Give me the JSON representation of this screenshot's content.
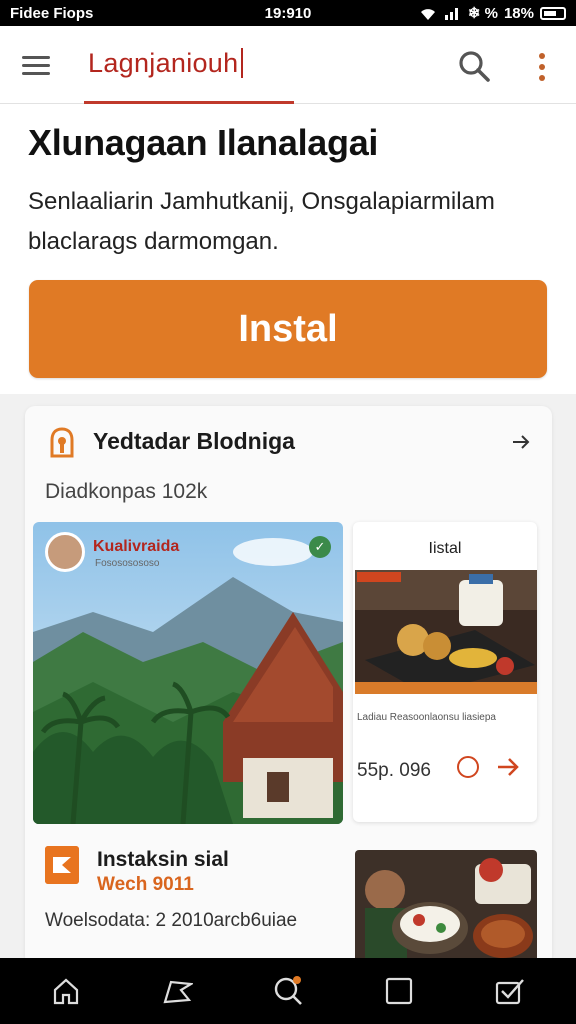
{
  "status": {
    "carrier": "Fidee Fiops",
    "time": "19:910",
    "battery": "18%",
    "indicators": "❄ %"
  },
  "appbar": {
    "title": "Lagnjaniouh",
    "menu_icon": "menu-icon",
    "search_icon": "search-icon",
    "more_icon": "more-vert-icon"
  },
  "hero": {
    "heading": "Xlunagaan Ilanalagai",
    "text": "Senlaaliarin Jamhutkanij, Onsgalapiarmilam blaclarags darmomgan.",
    "install_label": "Instal"
  },
  "card": {
    "title": "Yedtadar Blodniga",
    "subtitle": "Diadkonpas 102k",
    "photo": {
      "title": "Kualivraida",
      "meta": "Fosososososo"
    },
    "food": {
      "title": "Iistal",
      "caption": "Ladiau Reasoonlaonsu liasiepa",
      "price": "55p. 096"
    },
    "item2": {
      "title": "Instaksin sial",
      "subtitle": "Wech 9011",
      "meta": "Woelsodata: 2 2010arcb6uiae"
    }
  },
  "colors": {
    "accent": "#e07a25",
    "brand_red": "#b3261e"
  },
  "nav": [
    "home-icon",
    "explore-icon",
    "search-icon",
    "tabs-icon",
    "checked-box-icon"
  ]
}
